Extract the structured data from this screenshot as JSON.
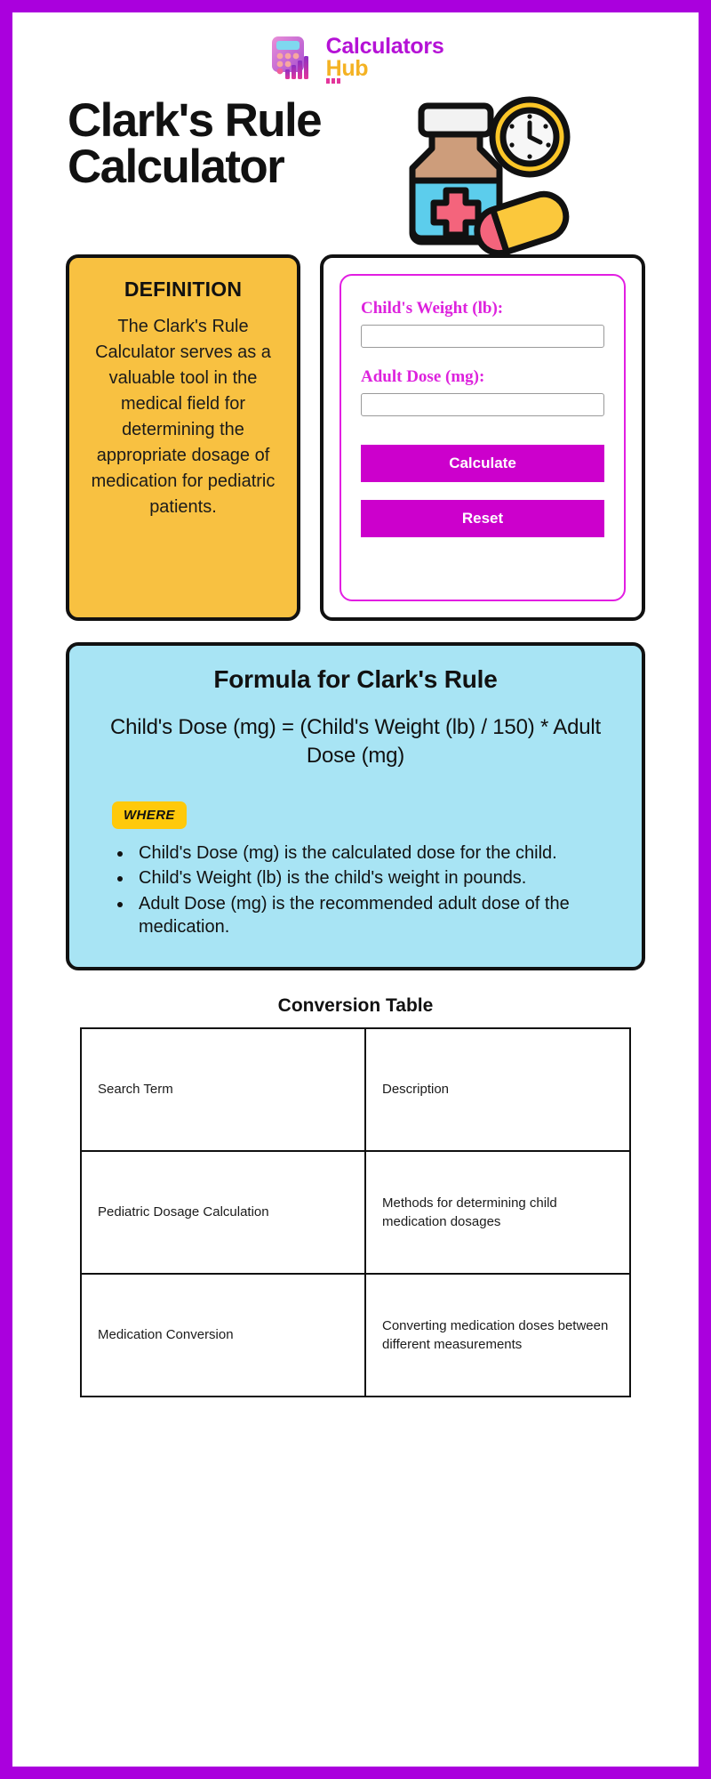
{
  "brand": {
    "line1": "Calculators",
    "line2": "Hub",
    "logo_icon": "calculator-bar-chart-logo-icon"
  },
  "hero": {
    "title": "Clark's Rule Calculator",
    "illustration": {
      "icon": "medicine-bottle-clock-pill-illustration",
      "parts": [
        "medicine-bottle-icon",
        "clock-icon",
        "pill-capsule-icon",
        "medical-cross-icon"
      ]
    }
  },
  "definition": {
    "heading": "DEFINITION",
    "text": "The Clark's Rule Calculator serves as a valuable tool in the medical field for determining the appropriate dosage of medication for pediatric patients."
  },
  "calculator": {
    "fields": [
      {
        "label": "Child's Weight (lb):",
        "value": "",
        "placeholder": ""
      },
      {
        "label": "Adult Dose (mg):",
        "value": "",
        "placeholder": ""
      }
    ],
    "calculate_label": "Calculate",
    "reset_label": "Reset"
  },
  "formula": {
    "title": "Formula for Clark's Rule",
    "equation": "Child's Dose (mg) = (Child's Weight (lb) / 150) * Adult Dose (mg)",
    "where_label": "WHERE",
    "items": [
      "Child's Dose (mg) is the calculated dose for the child.",
      "Child's Weight (lb) is the child's weight in pounds.",
      "Adult Dose (mg) is the recommended adult dose of the medication."
    ]
  },
  "conversion_table": {
    "title": "Conversion Table",
    "headers": [
      "Search Term",
      "Description"
    ],
    "rows": [
      [
        "Pediatric Dosage Calculation",
        "Methods for determining child medication dosages"
      ],
      [
        "Medication Conversion",
        "Converting medication doses between different measurements"
      ]
    ]
  },
  "colors": {
    "page_border": "#aa00dd",
    "definition_bg": "#f8c141",
    "formula_bg": "#a8e4f4",
    "button_bg": "#cc00cc",
    "label_magenta": "#dd22dd",
    "where_badge_bg": "#ffc90b",
    "brand_purple": "#b512d6",
    "brand_yellow": "#f4b223"
  }
}
